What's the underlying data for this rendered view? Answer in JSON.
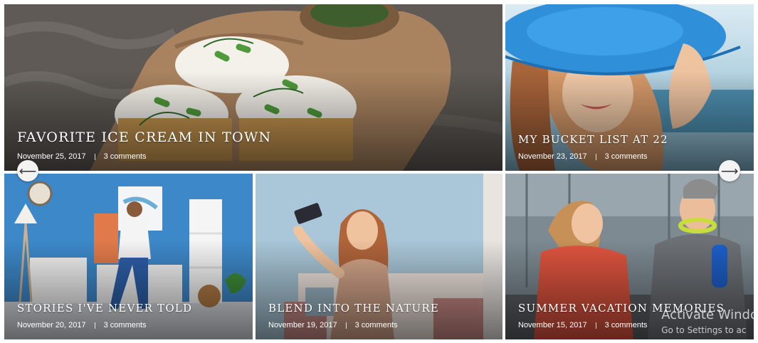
{
  "posts": [
    {
      "title": "FAVORITE ICE CREAM IN TOWN",
      "date": "November 25, 2017",
      "comments": "3 comments"
    },
    {
      "title": "MY BUCKET LIST AT 22",
      "date": "November 23, 2017",
      "comments": "3 comments"
    },
    {
      "title": "STORIES I'VE NEVER TOLD",
      "date": "November 20, 2017",
      "comments": "3 comments"
    },
    {
      "title": "BLEND INTO THE NATURE",
      "date": "November 19, 2017",
      "comments": "3 comments"
    },
    {
      "title": "SUMMER VACATION MEMORIES",
      "date": "November 15, 2017",
      "comments": "3 comments"
    }
  ],
  "slider": {
    "prev_icon": "arrow-left-icon",
    "next_icon": "arrow-right-icon",
    "prev_glyph": "⟵",
    "next_glyph": "⟶"
  },
  "watermark": {
    "line1": "Activate Windo",
    "line2": "Go to Settings to ac"
  }
}
